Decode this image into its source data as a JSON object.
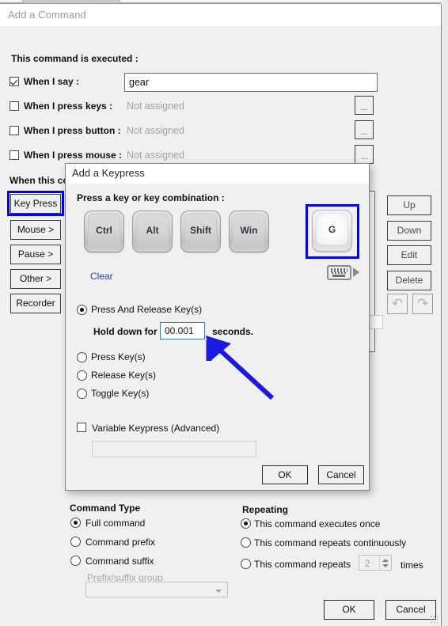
{
  "main_window": {
    "title": "Add a Command",
    "exec_section_label": "This command is executed :",
    "triggers": [
      {
        "label": "When I say :",
        "checked": true,
        "value": "gear",
        "has_browse": false
      },
      {
        "label": "When I press keys :",
        "checked": false,
        "value": "Not assigned",
        "browse_label": "..."
      },
      {
        "label": "When I press button :",
        "checked": false,
        "value": "Not assigned",
        "browse_label": "..."
      },
      {
        "label": "When I press mouse :",
        "checked": false,
        "value": "Not assigned",
        "browse_label": "..."
      }
    ],
    "when_this_command_label": "When this co",
    "action_buttons": [
      {
        "label": "Key Press",
        "focused": true
      },
      {
        "label": "Mouse >",
        "focused": false
      },
      {
        "label": "Pause >",
        "focused": false
      },
      {
        "label": "Other >",
        "focused": false
      },
      {
        "label": "Recorder",
        "focused": false
      }
    ],
    "list_buttons": [
      {
        "label": "Up"
      },
      {
        "label": "Down"
      },
      {
        "label": "Edit"
      },
      {
        "label": "Delete"
      }
    ],
    "undo_icon": "undo-arrow-icon",
    "redo_icon": "redo-arrow-icon",
    "command_type": {
      "title": "Command Type",
      "options": [
        {
          "label": "Full command",
          "selected": true
        },
        {
          "label": "Command prefix",
          "selected": false
        },
        {
          "label": "Command suffix",
          "selected": false
        }
      ],
      "group_label": "Prefix/suffix group",
      "group_value": ""
    },
    "repeating": {
      "title": "Repeating",
      "options": [
        {
          "label": "This command executes once",
          "selected": true
        },
        {
          "label": "This command repeats continuously",
          "selected": false
        },
        {
          "label": "This command repeats",
          "selected": false
        }
      ],
      "repeat_count": "2",
      "times_label": "times"
    },
    "ok_label": "OK",
    "cancel_label": "Cancel"
  },
  "keypress_dialog": {
    "title": "Add a Keypress",
    "prompt": "Press a key or key combination :",
    "keys": [
      {
        "label": "Ctrl",
        "active": false,
        "highlighted": false
      },
      {
        "label": "Alt",
        "active": false,
        "highlighted": false
      },
      {
        "label": "Shift",
        "active": false,
        "highlighted": false
      },
      {
        "label": "Win",
        "active": false,
        "highlighted": false
      },
      {
        "label": "G",
        "active": true,
        "highlighted": true
      }
    ],
    "clear_label": "Clear",
    "keyboard_picker_icon": "keyboard-icon",
    "modes": [
      {
        "label": "Press And Release Key(s)",
        "selected": true
      },
      {
        "label": "Press Key(s)",
        "selected": false
      },
      {
        "label": "Release Key(s)",
        "selected": false
      },
      {
        "label": "Toggle Key(s)",
        "selected": false
      }
    ],
    "hold_down_label": "Hold down for",
    "hold_down_value": "00.001",
    "seconds_label": "seconds.",
    "variable_keypress_label": "Variable Keypress (Advanced)",
    "variable_keypress_checked": false,
    "variable_keypress_value": "",
    "ok_label": "OK",
    "cancel_label": "Cancel"
  },
  "annotation": {
    "arrow_color": "#1a1ae0",
    "highlight_color": "#0000ee"
  }
}
